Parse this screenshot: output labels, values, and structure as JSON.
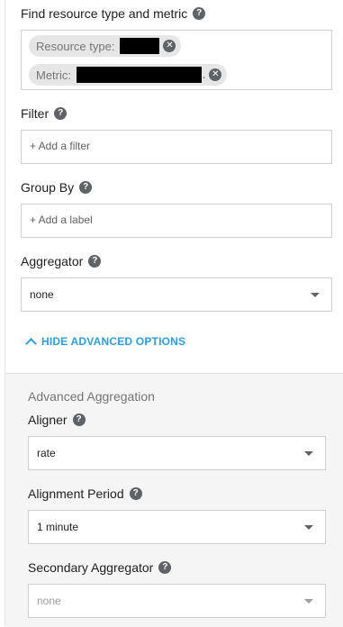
{
  "resource_section": {
    "label": "Find resource type and metric",
    "resource_type_label": "Resource type:",
    "metric_label": "Metric:",
    "metric_ellipsis": "."
  },
  "filter": {
    "label": "Filter",
    "placeholder": "+ Add a filter"
  },
  "group_by": {
    "label": "Group By",
    "placeholder": "+ Add a label"
  },
  "aggregator": {
    "label": "Aggregator",
    "value": "none"
  },
  "advanced_toggle": {
    "label": "HIDE ADVANCED OPTIONS"
  },
  "advanced": {
    "title": "Advanced Aggregation",
    "aligner": {
      "label": "Aligner",
      "value": "rate"
    },
    "alignment_period": {
      "label": "Alignment Period",
      "value": "1 minute"
    },
    "secondary_aggregator": {
      "label": "Secondary Aggregator",
      "value": "none"
    }
  },
  "icons": {
    "help": "help-circle-icon",
    "chip_close": "close-circle-icon",
    "dropdown": "caret-down-icon",
    "collapse": "chevron-up-icon"
  },
  "colors": {
    "accent": "#2a9fe6",
    "chip_bg": "#e6e6e6",
    "advanced_bg": "#f5f5f5"
  }
}
